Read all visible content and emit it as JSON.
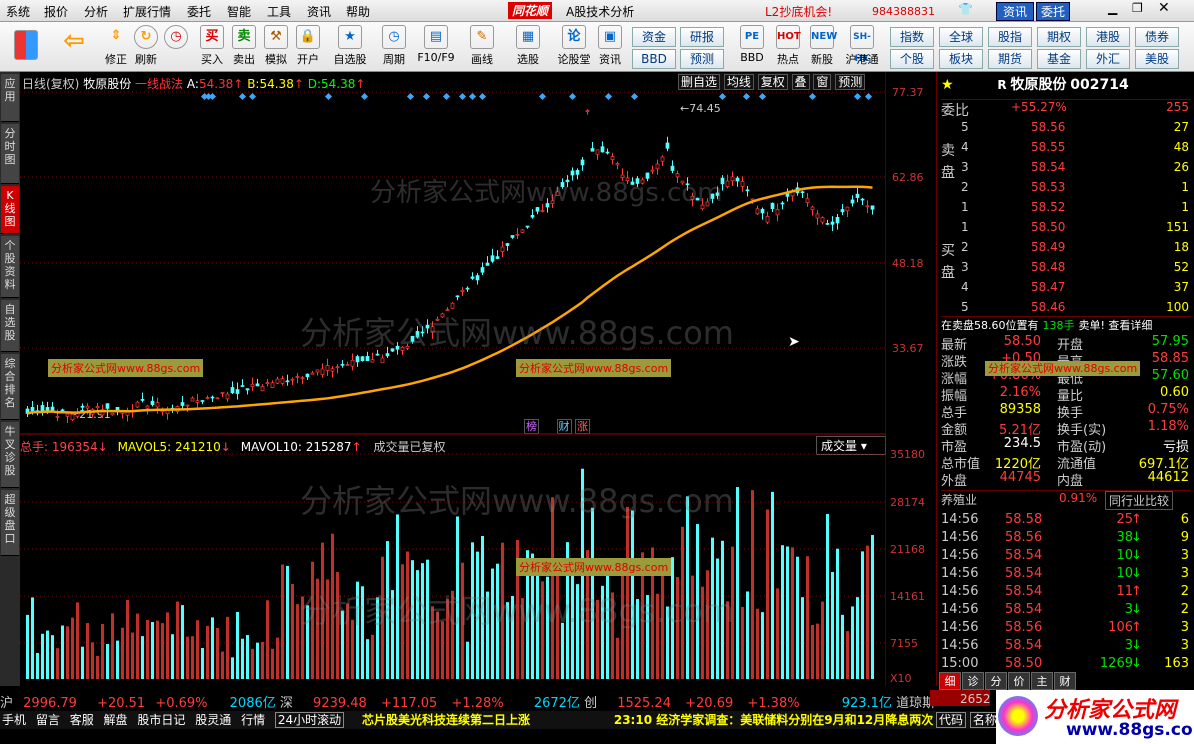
{
  "menu": [
    "系统",
    "报价",
    "分析",
    "扩展行情",
    "委托",
    "智能",
    "工具",
    "资讯",
    "帮助"
  ],
  "app_title": "A股技术分析",
  "brand": "同花顺",
  "promo": "L2抄底机会!",
  "account": "984388831",
  "topbtns": [
    "资讯",
    "委托"
  ],
  "toolbar": [
    "修正",
    "刷新",
    "买入",
    "卖出",
    "模拟",
    "开户",
    "自选股",
    "周期",
    "F10/F9",
    "画线",
    "选股",
    "论股堂",
    "资讯",
    "BBD",
    "热点",
    "新股",
    "沪港通"
  ],
  "toolbar_mid": [
    [
      "资金",
      "研报"
    ],
    [
      "BBD",
      "预测"
    ]
  ],
  "toolbar_right": [
    [
      "指数",
      "全球",
      "股指",
      "期权",
      "港股",
      "债券"
    ],
    [
      "个股",
      "板块",
      "期货",
      "基金",
      "外汇",
      "美股"
    ]
  ],
  "sidetabs": [
    "应用",
    "分时图",
    "K线图",
    "个股资料",
    "自选股",
    "综合排名",
    "牛叉诊股",
    "超级盘口"
  ],
  "kline": {
    "period": "日线(复权)",
    "name": "牧原股份",
    "indicator": "一线战法",
    "A": "54.38",
    "B": "54.38",
    "D": "54.38",
    "right_btns": [
      "删自选",
      "均线",
      "复权",
      "叠",
      "窗",
      "预测"
    ],
    "yticks": [
      "77.37",
      "62.86",
      "48.18",
      "33.67"
    ],
    "high": "74.45",
    "low": "21.91",
    "markers": [
      "榜",
      "财",
      "涨"
    ]
  },
  "volume": {
    "total": "总手: 196354",
    "mavol5": "MAVOL5: 241210",
    "mavol10": "MAVOL10: 215287",
    "note": "成交量已复权",
    "select": "成交量",
    "yticks": [
      "35180",
      "28174",
      "21168",
      "14161",
      "7155",
      "X10"
    ]
  },
  "watermarks": [
    "分析家公式网www.88gs.com",
    "分析家公式网www.88gs.com",
    "分析家公式网www.88gs.com",
    "分析家公式网www.88gs.com"
  ],
  "stock": {
    "code": "002714",
    "name": "牧原股份",
    "weibi_label": "委比",
    "weibi": "+55.27%",
    "weicha": "255",
    "sell_label": "卖盘",
    "buy_label": "买盘",
    "asks": [
      [
        "5",
        "58.56",
        "27"
      ],
      [
        "4",
        "58.55",
        "48"
      ],
      [
        "3",
        "58.54",
        "26"
      ],
      [
        "2",
        "58.53",
        "1"
      ],
      [
        "1",
        "58.52",
        "1"
      ]
    ],
    "bids": [
      [
        "1",
        "58.50",
        "151"
      ],
      [
        "2",
        "58.49",
        "18"
      ],
      [
        "3",
        "58.48",
        "52"
      ],
      [
        "4",
        "58.47",
        "37"
      ],
      [
        "5",
        "58.46",
        "100"
      ]
    ],
    "notice": "在卖盘58.60位置有",
    "notice_n": "138手",
    "notice_s": "卖单! 查看详细",
    "quote": [
      [
        "最新",
        "58.50",
        "开盘",
        "57.95"
      ],
      [
        "涨跌",
        "+0.50",
        "最高",
        "58.85"
      ],
      [
        "涨幅",
        "+0.86%",
        "最低",
        "57.60"
      ],
      [
        "振幅",
        "2.16%",
        "量比",
        "0.60"
      ],
      [
        "总手",
        "89358",
        "换手",
        "0.75%"
      ],
      [
        "金额",
        "5.21亿",
        "换手(实)",
        "1.18%"
      ],
      [
        "市盈",
        "234.5",
        "市盈(动)",
        "亏损"
      ],
      [
        "总市值",
        "1220亿",
        "流通值",
        "697.1亿"
      ],
      [
        "外盘",
        "44745",
        "内盘",
        "44612"
      ]
    ],
    "industry": "养殖业",
    "ind_pct": "0.91%",
    "ind_btn": "同行业比较",
    "ticks": [
      [
        "14:56",
        "58.58",
        "25",
        "6"
      ],
      [
        "14:56",
        "58.56",
        "38",
        "9"
      ],
      [
        "14:56",
        "58.54",
        "10",
        "3"
      ],
      [
        "14:56",
        "58.54",
        "10",
        "3"
      ],
      [
        "14:56",
        "58.54",
        "11",
        "2"
      ],
      [
        "14:56",
        "58.54",
        "3",
        "2"
      ],
      [
        "14:56",
        "58.56",
        "106",
        "3"
      ],
      [
        "14:56",
        "58.54",
        "3",
        "3"
      ],
      [
        "15:00",
        "58.50",
        "1269",
        "163"
      ]
    ],
    "tabs": [
      "细",
      "诊",
      "分",
      "价",
      "主",
      "财"
    ]
  },
  "status": {
    "sh": "沪",
    "sh_v": "2996.79",
    "sh_c": "+20.51",
    "sh_p": "+0.69%",
    "sh_a": "2086亿",
    "sz": "深",
    "sz_v": "9239.48",
    "sz_c": "+117.05",
    "sz_p": "+1.28%",
    "sz_a": "2672亿",
    "cy": "创",
    "cy_v": "1525.24",
    "cy_c": "+20.69",
    "cy_p": "+1.38%",
    "cy_a": "923.1亿",
    "dj": "道琼斯",
    "num": "2652",
    "btabs": [
      "手机",
      "留言",
      "客服",
      "解盘",
      "股市日记",
      "股灵通",
      "行情",
      "24小时滚动"
    ],
    "news1": "芯片股美光科技连续第二日上涨",
    "news2": "23:10 经济学家调查：美联储料分别在9月和12月降息两次",
    "code_label": "代码",
    "name_label": "名称"
  },
  "logo": {
    "cn": "分析家公式网",
    "url": "www.88gs.com"
  }
}
